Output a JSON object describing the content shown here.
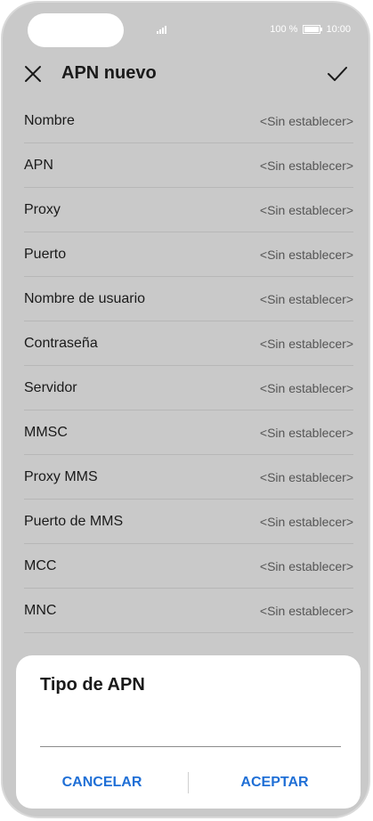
{
  "status": {
    "battery": "100 %",
    "time": "10:00"
  },
  "header": {
    "title": "APN nuevo"
  },
  "rows": [
    {
      "label": "Nombre",
      "value": "<Sin establecer>"
    },
    {
      "label": "APN",
      "value": "<Sin establecer>"
    },
    {
      "label": "Proxy",
      "value": "<Sin establecer>"
    },
    {
      "label": "Puerto",
      "value": "<Sin establecer>"
    },
    {
      "label": "Nombre de usuario",
      "value": "<Sin establecer>"
    },
    {
      "label": "Contraseña",
      "value": "<Sin establecer>"
    },
    {
      "label": "Servidor",
      "value": "<Sin establecer>"
    },
    {
      "label": "MMSC",
      "value": "<Sin establecer>"
    },
    {
      "label": "Proxy MMS",
      "value": "<Sin establecer>"
    },
    {
      "label": "Puerto de MMS",
      "value": "<Sin establecer>"
    },
    {
      "label": "MCC",
      "value": "<Sin establecer>"
    },
    {
      "label": "MNC",
      "value": "<Sin establecer>"
    }
  ],
  "dialog": {
    "title": "Tipo de APN",
    "input_value": "",
    "cancel_label": "CANCELAR",
    "accept_label": "ACEPTAR"
  }
}
